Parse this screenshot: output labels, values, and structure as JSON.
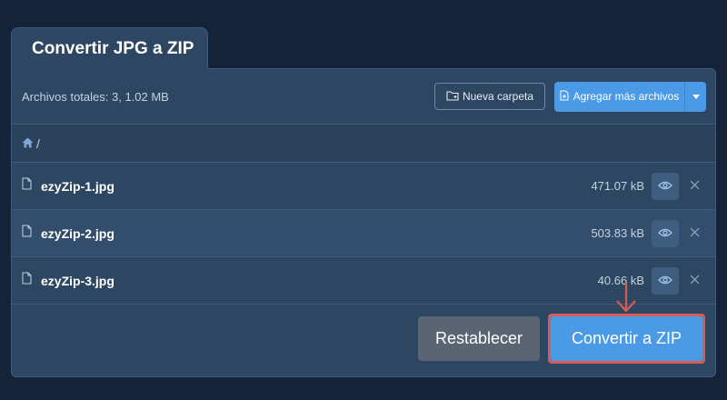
{
  "tab": {
    "title": "Convertir JPG a ZIP"
  },
  "toolbar": {
    "total_label": "Archivos totales: 3, 1.02 MB",
    "new_folder_label": "Nueva carpeta",
    "add_files_label": "Agregar más archivos"
  },
  "breadcrumb": {
    "separator": "/"
  },
  "files": [
    {
      "name": "ezyZip-1.jpg",
      "size": "471.07 kB"
    },
    {
      "name": "ezyZip-2.jpg",
      "size": "503.83 kB"
    },
    {
      "name": "ezyZip-3.jpg",
      "size": "40.66 kB"
    }
  ],
  "actions": {
    "reset_label": "Restablecer",
    "convert_label": "Convertir a ZIP"
  },
  "colors": {
    "background": "#142338",
    "panel": "#2d4763",
    "accent": "#4a9ae6",
    "reset": "#5a6472",
    "highlight": "#d95b55"
  },
  "icons": [
    "folder-plus-icon",
    "file-plus-icon",
    "caret-down-icon",
    "home-icon",
    "file-icon",
    "eye-icon",
    "close-icon",
    "arrow-down-icon"
  ]
}
